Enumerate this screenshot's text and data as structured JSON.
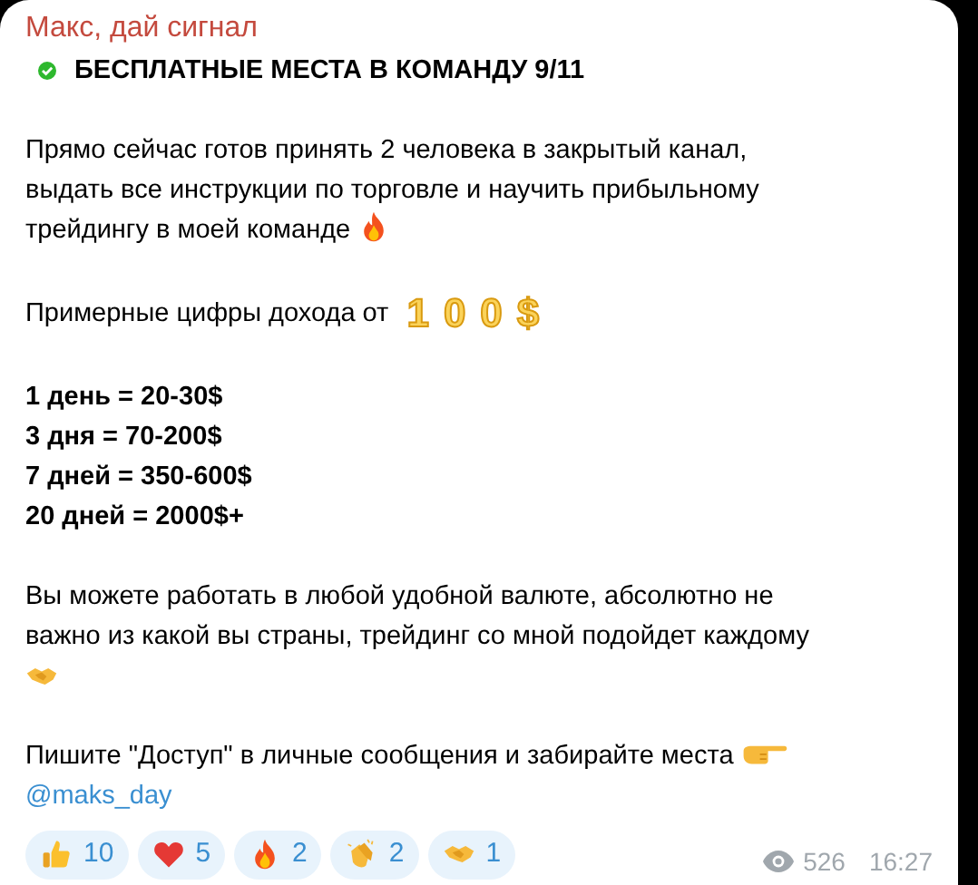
{
  "sender": "Макс, дай сигнал",
  "headline": "БЕСПЛАТНЫЕ МЕСТА В КОМАНДУ 9/11",
  "blocks": [
    {
      "kind": "text",
      "lines": [
        "Прямо сейчас готов принять 2 человека в закрытый канал,",
        "выдать все инструкции по торговле и научить прибыльному",
        "трейдингу в моей команде"
      ],
      "emoji": {
        "kind": "fire"
      }
    },
    {
      "kind": "amount",
      "text": "Примерные цифры дохода от",
      "amount": "100$"
    },
    {
      "kind": "list",
      "lines": [
        "1 день = 20-30$",
        "3 дня = 70-200$",
        "7 дней = 350-600$",
        "20 дней = 2000$+"
      ]
    },
    {
      "kind": "text",
      "lines": [
        "Вы можете работать в любой удобной валюте, абсолютно не",
        "важно из какой вы страны, трейдинг со мной подойдет каждому"
      ],
      "emoji": {
        "kind": "handshake",
        "own_line": true
      }
    },
    {
      "kind": "contact",
      "text": "Пишите \"Доступ\" в личные сообщения и забирайте места",
      "emoji": {
        "kind": "pointing"
      },
      "link": "@maks_day"
    }
  ],
  "reactions": [
    {
      "kind": "thumbs",
      "count": "10"
    },
    {
      "kind": "heart",
      "count": "5"
    },
    {
      "kind": "fire",
      "count": "2"
    },
    {
      "kind": "clap",
      "count": "2"
    },
    {
      "kind": "handshake",
      "count": "1"
    }
  ],
  "views": "526",
  "time": "16:27"
}
